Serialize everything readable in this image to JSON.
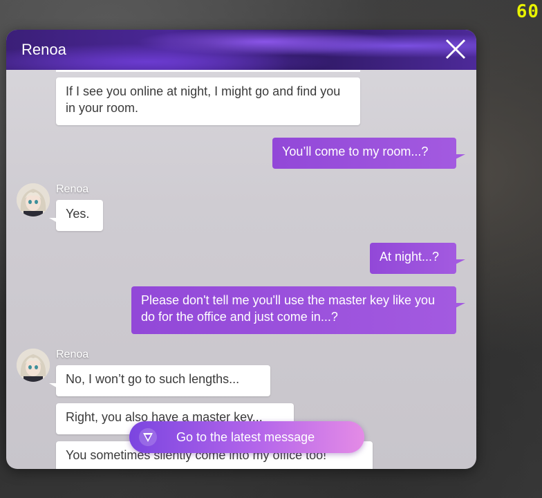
{
  "overlay": {
    "fps": "60"
  },
  "chat": {
    "title": "Renoa",
    "latest_button_label": "Go to the latest message",
    "messages": [
      {
        "from": "Renoa",
        "text": "If I see you online at night, I might go and find you in your room."
      },
      {
        "from": "me",
        "text": "You’ll come to my room...?"
      },
      {
        "from": "Renoa",
        "name": "Renoa",
        "text": "Yes."
      },
      {
        "from": "me",
        "text": "At night...?"
      },
      {
        "from": "me",
        "text": "Please don't tell me you'll use the master key like you do for the office and just come in...?"
      },
      {
        "from": "Renoa",
        "name": "Renoa",
        "text": "No, I won’t go to such lengths..."
      },
      {
        "from": "Renoa",
        "text": "Right, you also have a master key..."
      },
      {
        "from": "Renoa",
        "text": "You sometimes silently come into my office too!"
      }
    ]
  },
  "colors": {
    "accent_purple": "#9248d8",
    "incoming_bubble": "#ffffff",
    "fps_text": "#e8f300"
  },
  "icons": {
    "close": "close-icon",
    "scroll_down": "chevron-down-icon",
    "avatar": "avatar"
  }
}
